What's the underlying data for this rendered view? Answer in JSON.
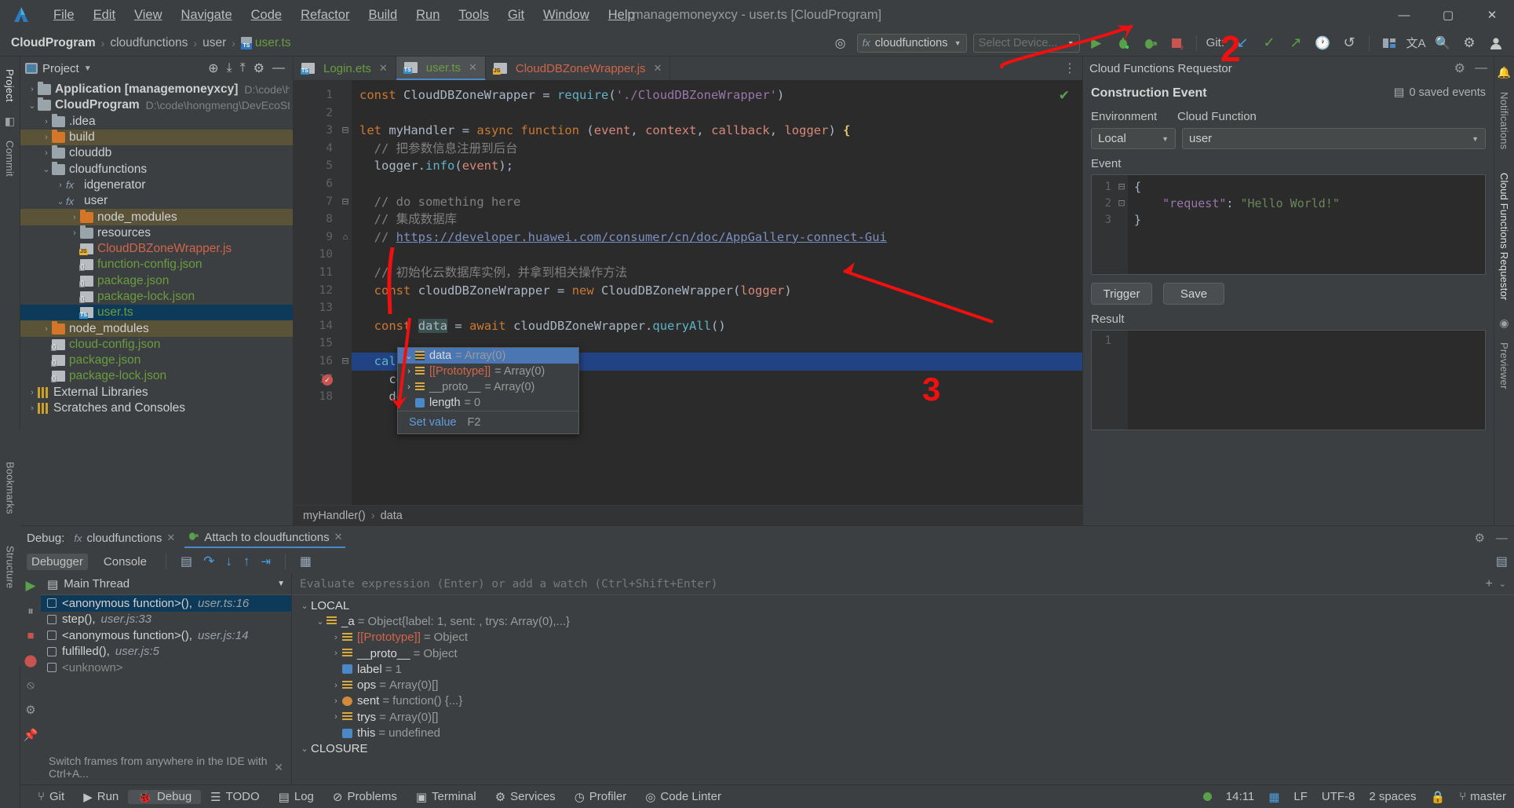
{
  "window": {
    "title": "managemoneyxcy - user.ts [CloudProgram]",
    "minimize": "—",
    "maximize": "▢",
    "close": "✕"
  },
  "menu": [
    "File",
    "Edit",
    "View",
    "Navigate",
    "Code",
    "Refactor",
    "Build",
    "Run",
    "Tools",
    "Git",
    "Window",
    "Help"
  ],
  "breadcrumb": {
    "project": "CloudProgram",
    "folder": "cloudfunctions",
    "sub": "user",
    "file": "user.ts",
    "sep": "›"
  },
  "toolbar": {
    "run_config": "cloudfunctions",
    "device": "Select Device...",
    "git_label": "Git:",
    "run_icon": "▶",
    "debug_icon": "🐞",
    "attach_icon": "🐞",
    "stop_icon": "■",
    "update_icon": "↙",
    "commit_icon": "✓",
    "push_icon": "↗",
    "history_icon": "🕐",
    "rollback_icon": "↺",
    "layout_icon": "▥",
    "translate_icon": "文A",
    "search_icon": "🔍",
    "settings_icon": "⚙",
    "account_icon": "👤",
    "settings_gear": "◎"
  },
  "left_rail": [
    "Project",
    "Commit"
  ],
  "right_rail": [
    "Notifications",
    "Cloud Functions Requestor",
    "Previewer"
  ],
  "bottom_rail": [
    "Bookmarks",
    "Structure"
  ],
  "project_panel": {
    "title": "Project",
    "icons": {
      "locate": "⊕",
      "expand": "⤓",
      "collapse": "⤒",
      "settings": "⚙",
      "hide": "—"
    },
    "tree": [
      {
        "indent": 0,
        "arrow": "›",
        "icon": "folder-module",
        "name": "Application [managemoneyxcy]",
        "bold": true,
        "path": "D:\\code\\hongmer",
        "state": "normal"
      },
      {
        "indent": 0,
        "arrow": "⌄",
        "icon": "folder-cloud",
        "name": "CloudProgram",
        "bold": true,
        "path": "D:\\code\\hongmeng\\DevEcoStudioP",
        "state": "normal"
      },
      {
        "indent": 1,
        "arrow": "›",
        "icon": "folder",
        "name": ".idea",
        "state": "normal"
      },
      {
        "indent": 1,
        "arrow": "›",
        "icon": "folder-orange",
        "name": "build",
        "state": "highlight"
      },
      {
        "indent": 1,
        "arrow": "›",
        "icon": "folder-db",
        "name": "clouddb",
        "state": "normal"
      },
      {
        "indent": 1,
        "arrow": "⌄",
        "icon": "folder-fn",
        "name": "cloudfunctions",
        "state": "normal"
      },
      {
        "indent": 2,
        "arrow": "›",
        "icon": "fx",
        "name": "idgenerator",
        "state": "normal"
      },
      {
        "indent": 2,
        "arrow": "⌄",
        "icon": "fx",
        "name": "user",
        "state": "normal"
      },
      {
        "indent": 3,
        "arrow": "›",
        "icon": "folder-orange",
        "name": "node_modules",
        "state": "highlight"
      },
      {
        "indent": 3,
        "arrow": "›",
        "icon": "folder",
        "name": "resources",
        "state": "normal"
      },
      {
        "indent": 3,
        "arrow": "",
        "icon": "js",
        "name": "CloudDBZoneWrapper.js",
        "color": "red",
        "state": "normal"
      },
      {
        "indent": 3,
        "arrow": "",
        "icon": "json",
        "name": "function-config.json",
        "color": "green",
        "state": "normal"
      },
      {
        "indent": 3,
        "arrow": "",
        "icon": "json",
        "name": "package.json",
        "color": "green",
        "state": "normal"
      },
      {
        "indent": 3,
        "arrow": "",
        "icon": "json",
        "name": "package-lock.json",
        "color": "green",
        "state": "normal"
      },
      {
        "indent": 3,
        "arrow": "",
        "icon": "ts",
        "name": "user.ts",
        "color": "green",
        "state": "selected"
      },
      {
        "indent": 1,
        "arrow": "›",
        "icon": "folder-orange",
        "name": "node_modules",
        "state": "highlight"
      },
      {
        "indent": 1,
        "arrow": "",
        "icon": "json",
        "name": "cloud-config.json",
        "color": "green",
        "state": "normal"
      },
      {
        "indent": 1,
        "arrow": "",
        "icon": "json",
        "name": "package.json",
        "color": "green",
        "state": "normal"
      },
      {
        "indent": 1,
        "arrow": "",
        "icon": "json",
        "name": "package-lock.json",
        "color": "green",
        "state": "normal"
      },
      {
        "indent": 0,
        "arrow": "›",
        "icon": "lib",
        "name": "External Libraries",
        "state": "normal"
      },
      {
        "indent": 0,
        "arrow": "›",
        "icon": "lib",
        "name": "Scratches and Consoles",
        "state": "normal"
      }
    ]
  },
  "editor": {
    "tabs": [
      {
        "name": "Login.ets",
        "type": "ets",
        "active": false,
        "close": "✕"
      },
      {
        "name": "user.ts",
        "type": "ts",
        "active": true,
        "close": "✕"
      },
      {
        "name": "CloudDBZoneWrapper.js",
        "type": "js",
        "active": false,
        "close": "✕"
      }
    ],
    "more_icon": "⋮",
    "inspection_ok": "✔",
    "lines": [
      {
        "n": 1,
        "fold": "",
        "html": "<span class='kw'>const</span> <span class='cls'>CloudDBZoneWrapper</span> <span class='pnc'>=</span> <span class='fn'>require</span><span class='pnc'>(</span><span class='str'>'./CloudDBZoneWrapper'</span><span class='pnc'>)</span>"
      },
      {
        "n": 2,
        "fold": "",
        "html": ""
      },
      {
        "n": 3,
        "fold": "⊟",
        "html": "<span class='kw'>let</span> <span class='id'>myHandler</span> <span class='pnc'>=</span> <span class='kw'>async</span> <span class='kw'>function</span> <span class='pnc'>(</span><span class='param'>event</span><span class='pnc'>,</span> <span class='param'>context</span><span class='pnc'>,</span> <span class='param'>callback</span><span class='pnc'>,</span> <span class='param'>logger</span><span class='pnc'>)</span> <span class='kw2'>{</span>"
      },
      {
        "n": 4,
        "fold": "",
        "html": "  <span class='cm'>// 把参数信息注册到后台</span>"
      },
      {
        "n": 5,
        "fold": "",
        "html": "  <span class='id'>logger</span><span class='pnc'>.</span><span class='fn'>info</span><span class='pnc'>(</span><span class='param'>event</span><span class='pnc'>);</span>"
      },
      {
        "n": 6,
        "fold": "",
        "html": ""
      },
      {
        "n": 7,
        "fold": "⊟",
        "html": "  <span class='cm'>// do something here</span>"
      },
      {
        "n": 8,
        "fold": "",
        "html": "  <span class='cm'>// 集成数据库</span>"
      },
      {
        "n": 9,
        "fold": "⌂",
        "html": "  <span class='cm'>// </span><span class='lnk'>https://developer.huawei.com/consumer/cn/doc/AppGallery-connect-Gui</span>"
      },
      {
        "n": 10,
        "fold": "",
        "html": ""
      },
      {
        "n": 11,
        "fold": "",
        "html": "  <span class='cm'>// 初始化云数据库实例，并拿到相关操作方法</span>"
      },
      {
        "n": 12,
        "fold": "",
        "html": "  <span class='kw'>const</span> <span class='id'>cloudDBZoneWrapper</span> <span class='pnc'>=</span> <span class='kw'>new</span> <span class='cls'>CloudDBZoneWrapper</span><span class='pnc'>(</span><span class='param'>logger</span><span class='pnc'>)</span>"
      },
      {
        "n": 13,
        "fold": "",
        "html": ""
      },
      {
        "n": 14,
        "fold": "",
        "html": "  <span class='kw'>const</span> <span class='id var-hl'>data</span> <span class='pnc'>=</span> <span class='kw'>await</span> <span class='id'>cloudDBZoneWrapper</span><span class='pnc'>.</span><span class='fn'>queryAll</span><span class='pnc'>()</span>"
      },
      {
        "n": 15,
        "fold": "",
        "html": ""
      },
      {
        "n": 16,
        "fold": "⊟",
        "html": "  <span class='fn'>callbac</span>"
      },
      {
        "n": 17,
        "fold": "",
        "html": "    <span class='id'>code:</span>"
      },
      {
        "n": 18,
        "fold": "",
        "html": "    <span class='id'>desc:</span>"
      }
    ],
    "value_popup": {
      "rows": [
        {
          "arrow": "⌄",
          "name": "data",
          "value": "= Array(0)",
          "selected": true,
          "icon": "array"
        },
        {
          "arrow": "›",
          "name": "[[Prototype]]",
          "value": "= Array(0)",
          "color": "red",
          "icon": "array"
        },
        {
          "arrow": "›",
          "name": "__proto__",
          "value": "= Array(0)",
          "color": "grey",
          "icon": "array"
        },
        {
          "arrow": "",
          "name": "length",
          "value": "= 0",
          "icon": "number"
        }
      ],
      "action": "Set value",
      "shortcut": "F2"
    },
    "breadcrumb_strip": [
      "myHandler()",
      "data"
    ],
    "breadcrumb_sep": "›"
  },
  "requestor": {
    "title": "Cloud Functions Requestor",
    "section_title": "Construction Event",
    "saved_events": "0 saved events",
    "saved_events_icon": "▤",
    "label_environment": "Environment",
    "label_cloud_function": "Cloud Function",
    "environment_value": "Local",
    "cloud_function_value": "user",
    "event_label": "Event",
    "event_lines": [
      {
        "n": "1",
        "fold": "⊟",
        "html": "<span class='b'>{</span>"
      },
      {
        "n": "2",
        "fold": "",
        "html": "    <span class='k'>\"request\"</span><span class='b'>:</span> <span class='v'>\"Hello World!\"</span>"
      },
      {
        "n": "3",
        "fold": "⊡",
        "html": "<span class='b'>}</span>"
      }
    ],
    "trigger_button": "Trigger",
    "save_button": "Save",
    "result_label": "Result",
    "result_lines": [
      "1"
    ],
    "settings_icon": "⚙",
    "hide_icon": "—"
  },
  "debug": {
    "label": "Debug:",
    "config_tab": "cloudfunctions",
    "attach_tab": "Attach to cloudfunctions",
    "close_icon": "✕",
    "tabs": [
      "Debugger",
      "Console"
    ],
    "active_tab": "Debugger",
    "toolbar_icons": [
      "▤",
      "↷",
      "↓",
      "↑",
      "⇥",
      "▦"
    ],
    "settings_icon": "⚙",
    "hide_icon": "—",
    "console_icon": "▤",
    "thread_label": "Main Thread",
    "frames": [
      {
        "name": "<anonymous function>()",
        "loc": "user.ts:16",
        "selected": true,
        "grey": false
      },
      {
        "name": "step()",
        "loc": "user.js:33",
        "selected": false,
        "grey": false
      },
      {
        "name": "<anonymous function>()",
        "loc": "user.js:14",
        "selected": false,
        "grey": false
      },
      {
        "name": "fulfilled()",
        "loc": "user.js:5",
        "selected": false,
        "grey": false
      },
      {
        "name": "<unknown>",
        "loc": "",
        "selected": false,
        "grey": true
      }
    ],
    "frames_hint": "Switch frames from anywhere in the IDE with Ctrl+A...",
    "frames_hint_close": "✕",
    "eval_placeholder": "Evaluate expression (Enter) or add a watch (Ctrl+Shift+Enter)",
    "eval_add": "+",
    "eval_caret": "⌄",
    "variables": [
      {
        "indent": 0,
        "arrow": "⌄",
        "icon": "group",
        "name": "LOCAL",
        "eq": "",
        "value": ""
      },
      {
        "indent": 1,
        "arrow": "⌄",
        "icon": "array",
        "name": "_a",
        "eq": "=",
        "value": "Object{label: 1, sent: , trys: Array(0),...}"
      },
      {
        "indent": 2,
        "arrow": "›",
        "icon": "array",
        "name": "[[Prototype]]",
        "eq": "=",
        "value": "Object",
        "red": true
      },
      {
        "indent": 2,
        "arrow": "›",
        "icon": "array",
        "name": "__proto__",
        "eq": "=",
        "value": "Object"
      },
      {
        "indent": 2,
        "arrow": "",
        "icon": "number",
        "name": "label",
        "eq": "=",
        "value": "1"
      },
      {
        "indent": 2,
        "arrow": "›",
        "icon": "array",
        "name": "ops",
        "eq": "=",
        "value": "Array(0)[]"
      },
      {
        "indent": 2,
        "arrow": "›",
        "icon": "fn",
        "name": "sent",
        "eq": "=",
        "value": "function() {...}"
      },
      {
        "indent": 2,
        "arrow": "›",
        "icon": "array",
        "name": "trys",
        "eq": "=",
        "value": "Array(0)[]"
      },
      {
        "indent": 2,
        "arrow": "",
        "icon": "number",
        "name": "this",
        "eq": "=",
        "value": "undefined"
      },
      {
        "indent": 0,
        "arrow": "⌄",
        "icon": "group",
        "name": "CLOSURE",
        "eq": "",
        "value": ""
      }
    ]
  },
  "status_bar": {
    "items": [
      {
        "label": "Git",
        "icon": "⑂",
        "active": false
      },
      {
        "label": "Run",
        "icon": "▶",
        "active": false
      },
      {
        "label": "Debug",
        "icon": "🐞",
        "active": true
      },
      {
        "label": "TODO",
        "icon": "☰",
        "active": false
      },
      {
        "label": "Log",
        "icon": "▤",
        "active": false
      },
      {
        "label": "Problems",
        "icon": "⊘",
        "active": false
      },
      {
        "label": "Terminal",
        "icon": "▣",
        "active": false
      },
      {
        "label": "Services",
        "icon": "⚙",
        "active": false
      },
      {
        "label": "Profiler",
        "icon": "◷",
        "active": false
      },
      {
        "label": "Code Linter",
        "icon": "◎",
        "active": false
      }
    ],
    "time": "14:11",
    "lf": "LF",
    "encoding": "UTF-8",
    "indent": "2 spaces",
    "branch": "master",
    "branch_icon": "⑂",
    "lock_icon": "🔒",
    "flag_icon": "▦"
  },
  "annotations": {
    "marker_1_label": "",
    "marker_2_label": "2"
  }
}
